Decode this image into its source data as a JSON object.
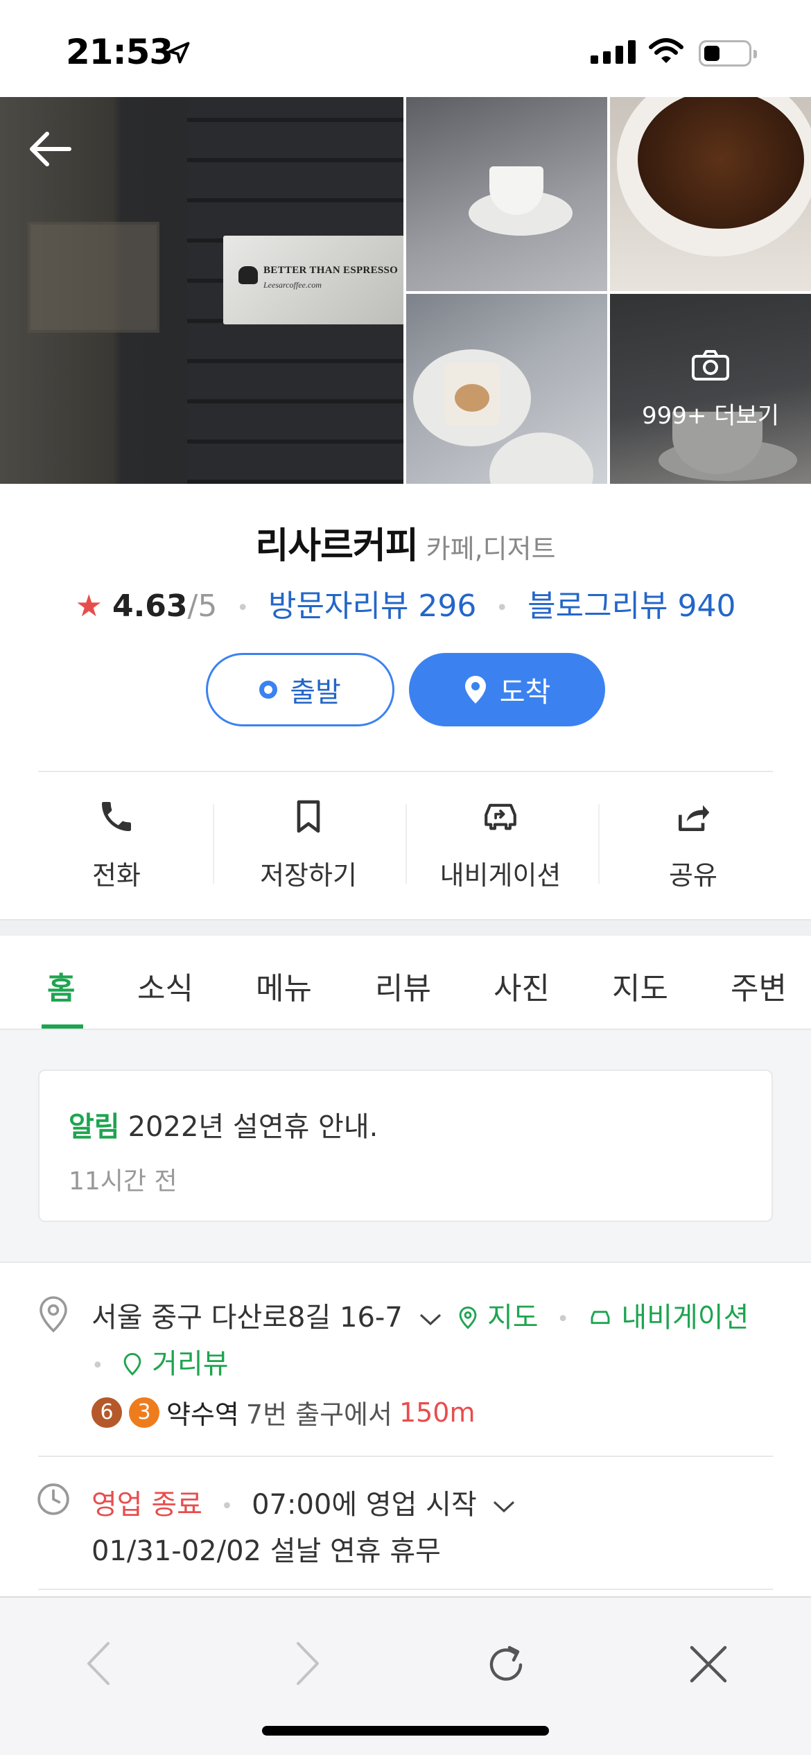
{
  "status_bar": {
    "time": "21:53"
  },
  "photos": {
    "sign_text": "BETTER THAN ESPRESSO",
    "sign_sub": "Leesarcoffee.com",
    "more_label": "999+ 더보기"
  },
  "place": {
    "name": "리사르커피",
    "category": "카페,디저트",
    "rating": "4.63",
    "rating_max": "/5",
    "visitor_reviews": "방문자리뷰 296",
    "blog_reviews": "블로그리뷰 940"
  },
  "buttons": {
    "start": "출발",
    "arrive": "도착"
  },
  "actions": [
    {
      "label": "전화",
      "icon": "phone-icon"
    },
    {
      "label": "저장하기",
      "icon": "bookmark-icon"
    },
    {
      "label": "내비게이션",
      "icon": "navigation-car-icon"
    },
    {
      "label": "공유",
      "icon": "share-icon"
    }
  ],
  "tabs": [
    "홈",
    "소식",
    "메뉴",
    "리뷰",
    "사진",
    "지도",
    "주변"
  ],
  "notice": {
    "tag": "알림",
    "title": "2022년 설연휴 안내.",
    "time": "11시간 전"
  },
  "info": {
    "address": "서울 중구 다산로8길 16-7",
    "map_link": "지도",
    "navi_link": "내비게이션",
    "street_view_link": "거리뷰",
    "subway_lines": [
      {
        "number": "6",
        "color": "#b5592a"
      },
      {
        "number": "3",
        "color": "#ef7c1c"
      }
    ],
    "station": "약수역",
    "exit_text": "7번 출구에서",
    "distance": "150m",
    "status": "영업 종료",
    "open_time": "07:00에 영업 시작",
    "holiday": "01/31-02/02 설날 연휴 휴무"
  },
  "colors": {
    "accent_blue": "#3b82f0",
    "link_blue": "#2466c8",
    "green": "#1ea450",
    "red": "#e84d4d"
  }
}
